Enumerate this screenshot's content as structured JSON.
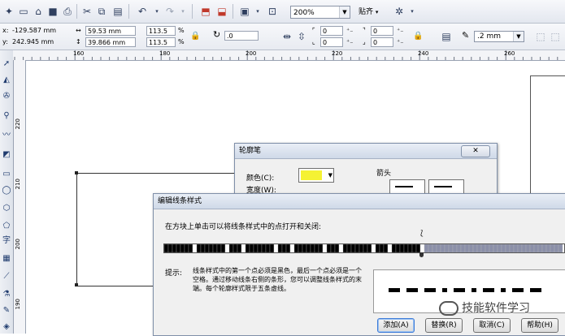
{
  "toolbar": {
    "zoom_value": "200%",
    "snap_label": "贴齐"
  },
  "property_bar": {
    "x_label": "x:",
    "x_value": "-129.587 mm",
    "y_label": "y:",
    "y_value": "242.945 mm",
    "width_value": "59.53 mm",
    "height_value": "39.866 mm",
    "scale_x_value": "113.5",
    "scale_y_value": "113.5",
    "percent": "%",
    "rotation_value": ".0",
    "corner_values": [
      "0",
      "0",
      "0",
      "0"
    ],
    "outline_width_value": ".2 mm"
  },
  "ruler": {
    "h_ticks": [
      "160",
      "180",
      "200",
      "220",
      "240",
      "260"
    ],
    "v_ticks": [
      "220",
      "210",
      "200",
      "190"
    ]
  },
  "outline_dialog": {
    "title": "轮廓笔",
    "color_label": "颜色(C):",
    "color_value": "#f5f233",
    "width_label": "宽度(W):",
    "arrows_label": "箭头"
  },
  "line_style_dialog": {
    "title": "编辑线条样式",
    "instruction": "在方块上单击可以将线条样式中的点打开和关闭:",
    "tip_label": "提示:",
    "tip_text": "线条样式中的第一个点必须是黑色，最后一个点必须是一个空格。通过移动线条右侧的条形，您可以调整线条样式的末端。每个轮廓样式限于五条虚线。",
    "buttons": {
      "add": "添加(A)",
      "replace": "替换(R)",
      "cancel": "取消(C)",
      "help": "帮助(H)"
    }
  },
  "watermark": {
    "text": "技能软件学习"
  }
}
